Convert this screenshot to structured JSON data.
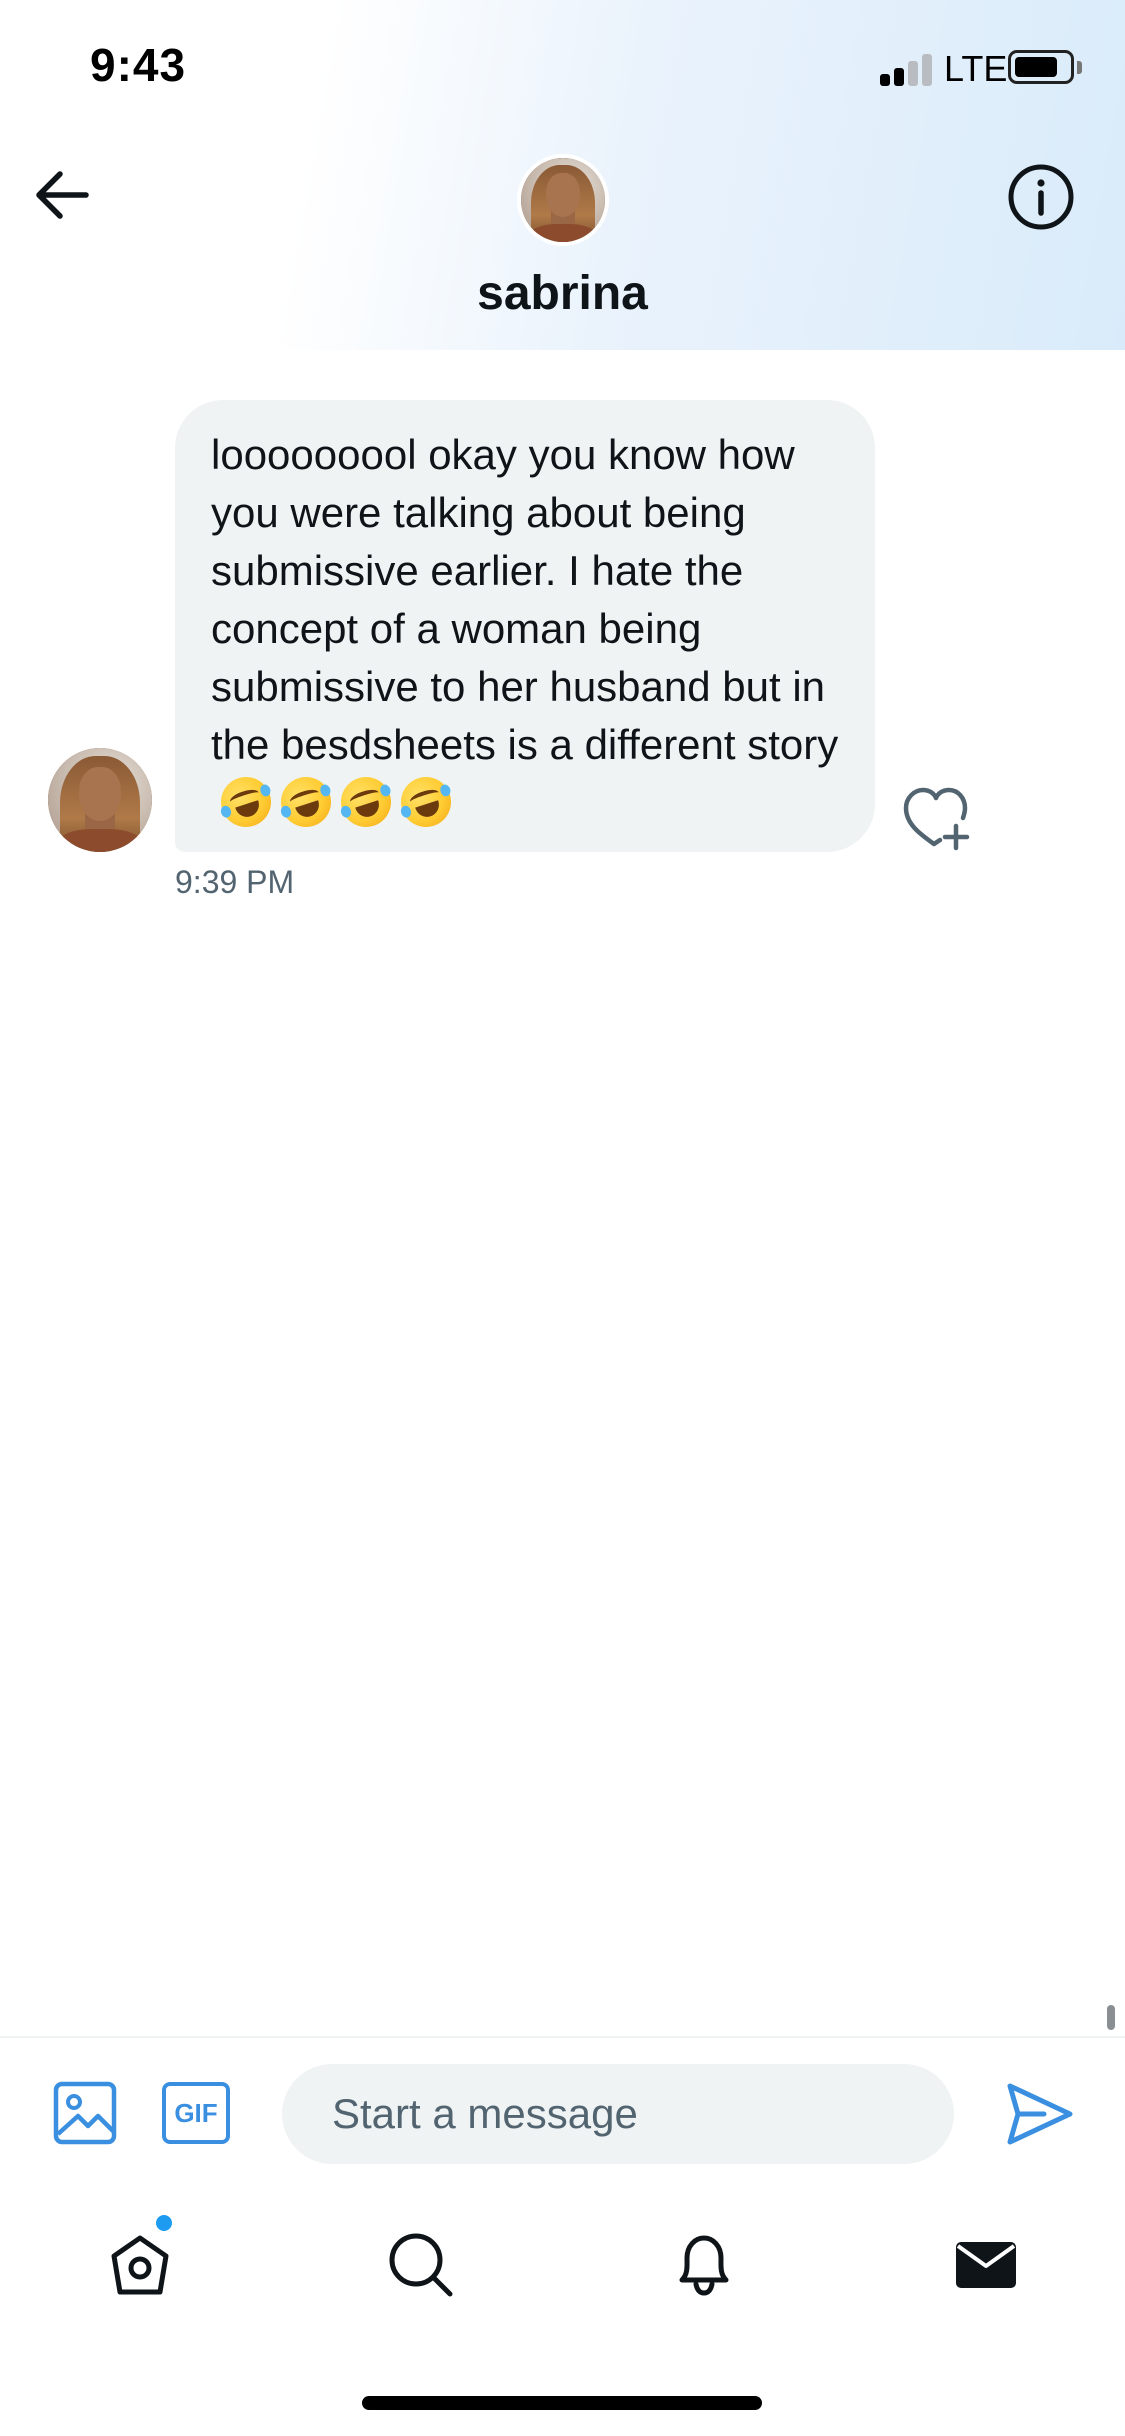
{
  "status_bar": {
    "time": "9:43",
    "network": "LTE",
    "signal_bars_active": 2,
    "signal_bars_total": 4,
    "battery_level": 0.7
  },
  "header": {
    "contact_name": "sabrina",
    "back_icon": "arrow-left-icon",
    "info_icon": "info-circle-icon"
  },
  "conversation": {
    "messages": [
      {
        "text": "looooooool okay you know how you were talking about being submissive earlier. I hate the concept of a woman being submissive to her husband but in the besdsheets is a different story",
        "emoji": "🤣🤣🤣🤣",
        "emoji_count": 4,
        "timestamp": "9:39 PM",
        "reaction_icon": "heart-plus-icon"
      }
    ]
  },
  "composer": {
    "placeholder": "Start a message",
    "image_icon": "image-icon",
    "gif_label": "GIF",
    "send_icon": "send-icon"
  },
  "tab_bar": {
    "items": [
      {
        "name": "home",
        "icon": "home-icon",
        "has_badge": true
      },
      {
        "name": "search",
        "icon": "search-icon",
        "has_badge": false
      },
      {
        "name": "notifications",
        "icon": "bell-icon",
        "has_badge": false
      },
      {
        "name": "messages",
        "icon": "mail-icon",
        "has_badge": false,
        "active": true
      }
    ]
  },
  "colors": {
    "accent": "#1d9bf0",
    "bubble": "#eff3f4",
    "secondary_text": "#536471",
    "primary_text": "#0f1419"
  }
}
